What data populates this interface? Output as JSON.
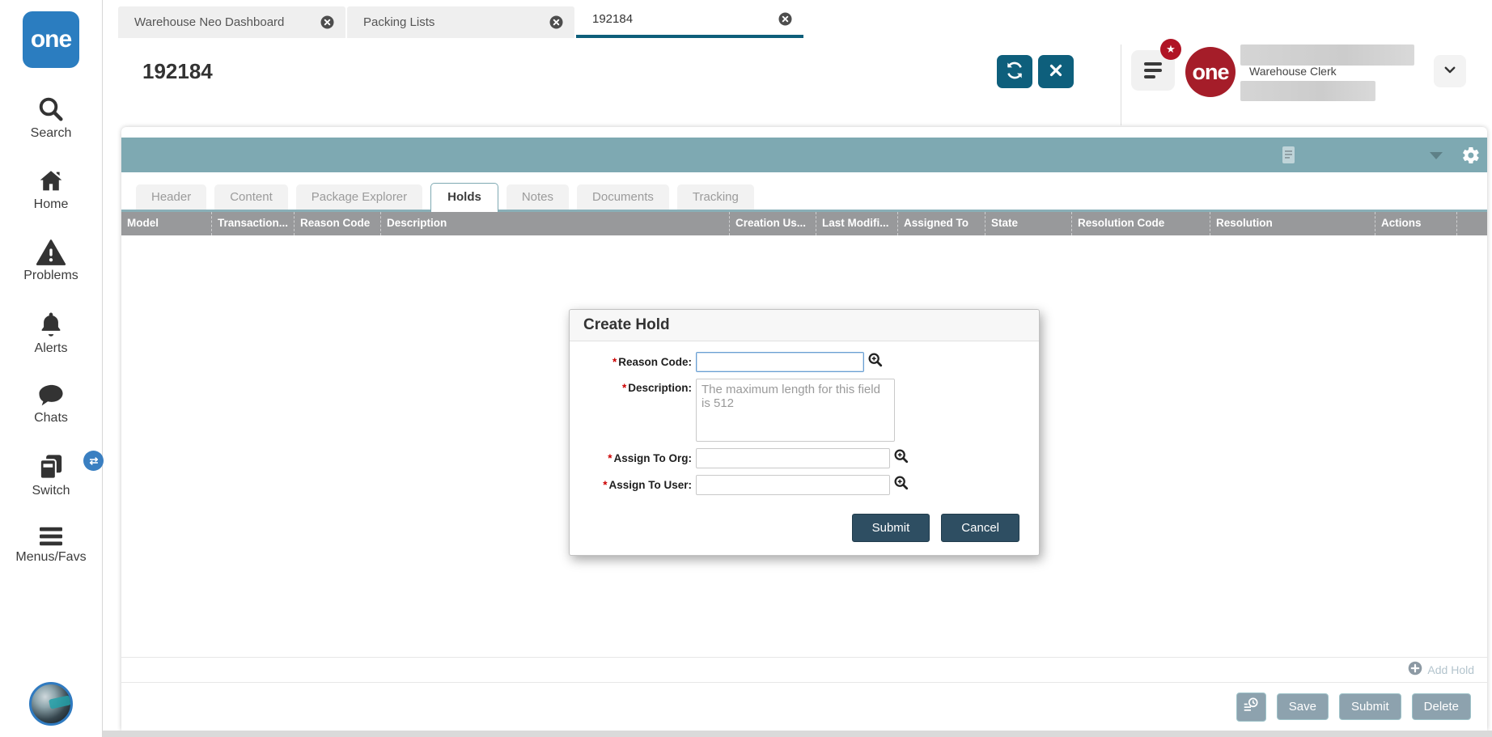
{
  "window": {
    "tabs": [
      {
        "label": "Warehouse Neo Dashboard",
        "active": false
      },
      {
        "label": "Packing Lists",
        "active": false
      },
      {
        "label": "192184",
        "active": true
      }
    ]
  },
  "sidebar": {
    "logo_text": "one",
    "items": [
      {
        "label": "Search",
        "icon": "search-icon"
      },
      {
        "label": "Home",
        "icon": "home-icon"
      },
      {
        "label": "Problems",
        "icon": "warning-triangle-icon"
      },
      {
        "label": "Alerts",
        "icon": "bell-icon"
      },
      {
        "label": "Chats",
        "icon": "chat-bubble-icon"
      },
      {
        "label": "Switch",
        "icon": "switch-windows-icon",
        "badge_icon": "swap-arrows-icon"
      },
      {
        "label": "Menus/Favs",
        "icon": "hamburger-icon"
      }
    ]
  },
  "header": {
    "title": "192184",
    "logo_text": "one",
    "user_role": "Warehouse Clerk"
  },
  "content": {
    "tabs": [
      {
        "label": "Header",
        "active": false
      },
      {
        "label": "Content",
        "active": false
      },
      {
        "label": "Package Explorer",
        "active": false
      },
      {
        "label": "Holds",
        "active": true
      },
      {
        "label": "Notes",
        "active": false
      },
      {
        "label": "Documents",
        "active": false
      },
      {
        "label": "Tracking",
        "active": false
      }
    ],
    "table": {
      "columns": [
        "Model",
        "Transaction...",
        "Reason Code",
        "Description",
        "Creation Us...",
        "Last Modifi...",
        "Assigned To",
        "State",
        "Resolution Code",
        "Resolution",
        "Actions"
      ],
      "rows": []
    },
    "add_hold_label": "Add Hold"
  },
  "modal": {
    "title": "Create Hold",
    "required_marker": "*",
    "fields": [
      {
        "label": "Reason Code:",
        "required": true,
        "type": "text",
        "value": "",
        "has_lookup": true,
        "focused": true
      },
      {
        "label": "Description:",
        "required": true,
        "type": "textarea",
        "value": "",
        "placeholder": "The maximum length for this field is 512"
      },
      {
        "label": "Assign To Org:",
        "required": true,
        "type": "text",
        "value": "",
        "has_lookup": true
      },
      {
        "label": "Assign To User:",
        "required": true,
        "type": "text",
        "value": "",
        "has_lookup": true
      }
    ],
    "submit_label": "Submit",
    "cancel_label": "Cancel"
  },
  "footer": {
    "save_label": "Save",
    "submit_label": "Submit",
    "delete_label": "Delete"
  },
  "icons": {
    "refresh-icon": "circular-arrows",
    "close-icon": "x-mark",
    "tab-close-icon": "circled-x",
    "menu-icon": "hamburger-with-star-badge",
    "chevron-down-icon": "v-chevron",
    "document-icon": "sheet-with-lines",
    "gear-icon": "settings-cog",
    "lookup-icon": "magnifier-with-plus",
    "add-icon": "circled-plus",
    "history-icon": "list-with-clock"
  },
  "colors": {
    "accent_teal_bar": "#7ea9b2",
    "dark_teal_button": "#0e5f7c",
    "brand_red": "#a51d29",
    "brand_blue": "#2b7dc0",
    "table_header_gray": "#98999b",
    "disabled_button_gray": "#8da2ae",
    "modal_button_dark": "#2e4e62",
    "badge_red": "#b01324",
    "required_red": "#cc0000"
  }
}
